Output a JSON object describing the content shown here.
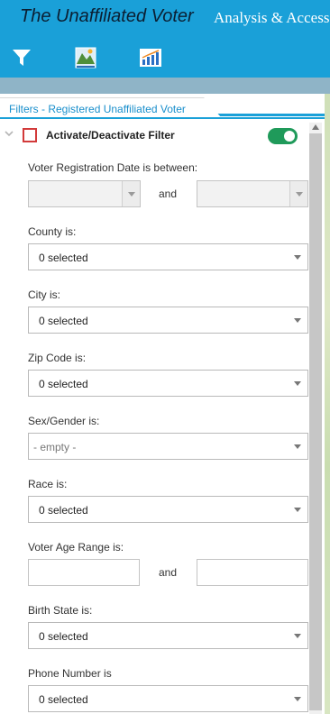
{
  "header": {
    "title": "The Unaffiliated Voter",
    "subtitle": "Analysis & Access"
  },
  "toolbar": {
    "tools": [
      {
        "icon": "filter-icon"
      },
      {
        "icon": "map-layers-icon"
      },
      {
        "icon": "bar-chart-icon"
      }
    ]
  },
  "panel": {
    "tab_label": "Filters - Registered Unaffiliated Voter",
    "filter_title": "Activate/Deactivate Filter",
    "filter_enabled": true,
    "fields": {
      "registration_date": {
        "label": "Voter Registration Date is between:",
        "and": "and",
        "start": "",
        "end": ""
      },
      "county": {
        "label": "County is:",
        "value": "0 selected"
      },
      "city": {
        "label": "City is:",
        "value": "0 selected"
      },
      "zip": {
        "label": "Zip Code is:",
        "value": "0 selected"
      },
      "sex": {
        "label": "Sex/Gender is:",
        "value": "- empty -"
      },
      "race": {
        "label": "Race is:",
        "value": "0 selected"
      },
      "age_range": {
        "label": "Voter Age Range is:",
        "and": "and",
        "min": "",
        "max": ""
      },
      "birth_state": {
        "label": "Birth State is:",
        "value": "0 selected"
      },
      "phone": {
        "label": "Phone Number is",
        "value": "0 selected"
      }
    }
  },
  "colors": {
    "header_blue": "#1aa0d8",
    "toggle_green": "#1f9a5a",
    "checkbox_red": "#d23a3a",
    "tab_text_blue": "#1a8fcc"
  }
}
